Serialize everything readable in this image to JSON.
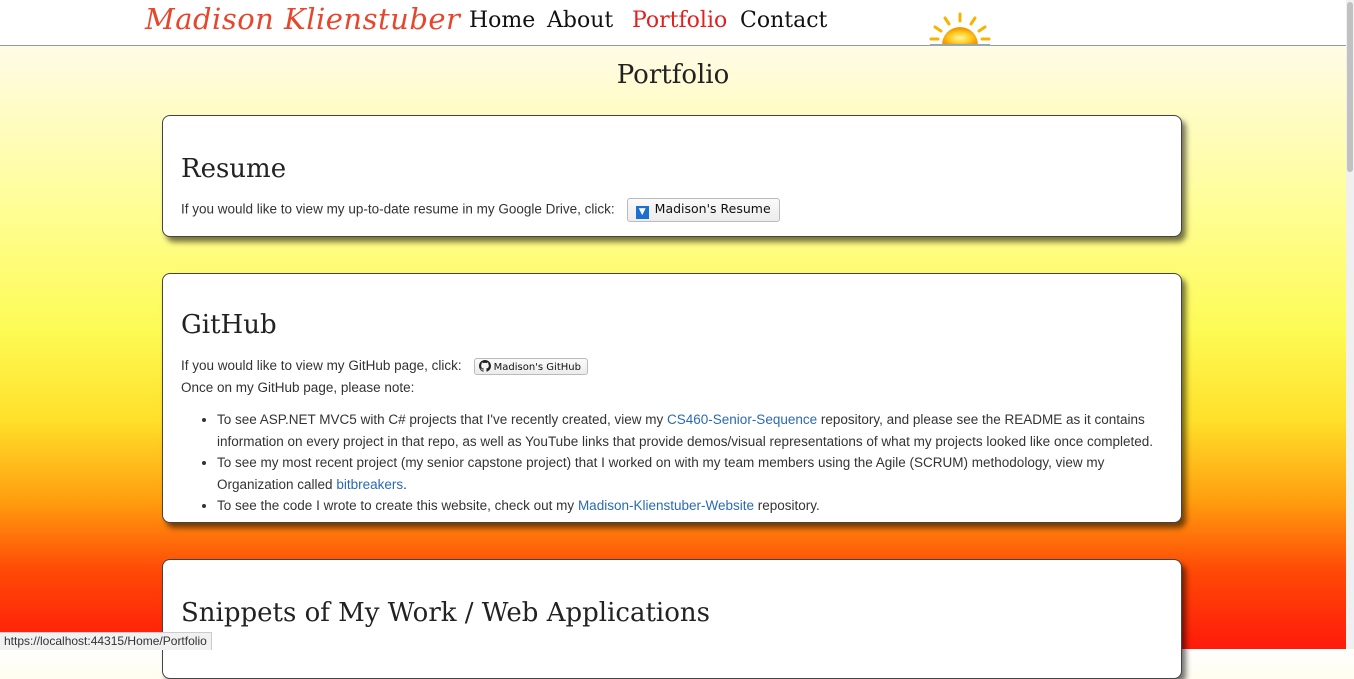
{
  "nav": {
    "brand": "Madison Klienstuber",
    "links": [
      "Home",
      "About",
      "Portfolio",
      "Contact"
    ],
    "active": "Portfolio",
    "logo_icon": "sun-icon"
  },
  "page_title": "Portfolio",
  "resume": {
    "heading": "Resume",
    "text": "If you would like to view my up-to-date resume in my Google Drive, click:",
    "button_label": "Madison's Resume",
    "button_icon": "google-drive-icon"
  },
  "github": {
    "heading": "GitHub",
    "text": "If you would like to view my GitHub page, click:",
    "button_label": "Madison's GitHub",
    "button_icon": "github-icon",
    "note_intro": "Once on my GitHub page, please note:",
    "items": [
      {
        "before": "To see ASP.NET MVC5 with C# projects that I've recently created, view my ",
        "link": "CS460-Senior-Sequence",
        "after": " repository, and please see the README as it contains information on every project in that repo, as well as YouTube links that provide demos/visual representations of what my projects looked like once completed."
      },
      {
        "before": "To see my most recent project (my senior capstone project) that I worked on with my team members using the Agile (SCRUM) methodology, view my Organization called ",
        "link": "bitbreakers",
        "after": "."
      },
      {
        "before": "To see the code I wrote to create this website, check out my ",
        "link": "Madison-Klienstuber-Website",
        "after": " repository."
      }
    ]
  },
  "snippets": {
    "heading": "Snippets of My Work / Web Applications"
  },
  "status_bar": "https://localhost:44315/Home/Portfolio",
  "colors": {
    "brand": "#e8462c",
    "active_link": "#e32020",
    "link": "#2a6ab3"
  }
}
